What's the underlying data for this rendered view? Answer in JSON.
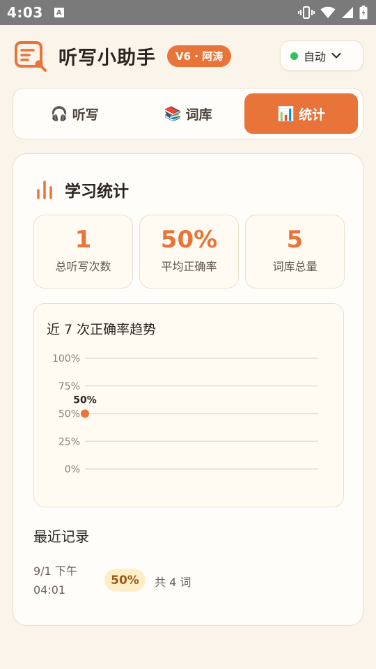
{
  "status_bar": {
    "time": "4:03",
    "notification_letter": "A"
  },
  "header": {
    "app_title": "听写小助手",
    "version_badge": "V6 · 阿涛",
    "mode": {
      "label": "自动",
      "dot_color": "#2ec25e"
    }
  },
  "tabs": [
    {
      "icon": "🎧",
      "label": "听写",
      "active": false
    },
    {
      "icon": "📚",
      "label": "词库",
      "active": false
    },
    {
      "icon": "📊",
      "label": "统计",
      "active": true
    }
  ],
  "stats_section": {
    "title": "学习统计",
    "cards": [
      {
        "value": "1",
        "label": "总听写次数"
      },
      {
        "value": "50%",
        "label": "平均正确率"
      },
      {
        "value": "5",
        "label": "词库总量"
      }
    ]
  },
  "chart_data": {
    "type": "line",
    "title": "近 7 次正确率趋势",
    "y_ticks": [
      "100%",
      "75%",
      "50%",
      "25%",
      "0%"
    ],
    "ylim": [
      0,
      100
    ],
    "points": [
      {
        "x": 1,
        "y": 50,
        "label": "50%"
      }
    ],
    "color": "#e8743a",
    "grid": true
  },
  "recent": {
    "title": "最近记录",
    "records": [
      {
        "date_line1": "9/1 下午",
        "date_line2": "04:01",
        "score": "50%",
        "count": "共 4 词"
      }
    ]
  },
  "colors": {
    "accent": "#e8743a",
    "background": "#fbf4ea",
    "card": "#fffdf9"
  }
}
